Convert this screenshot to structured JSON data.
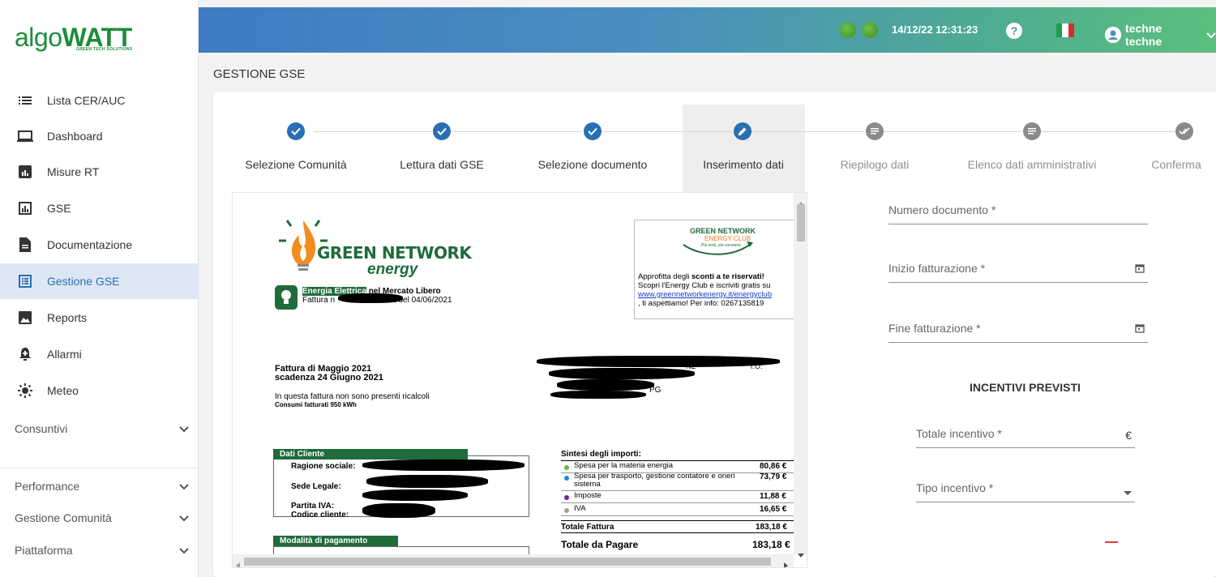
{
  "brand": {
    "name_part1": "algo",
    "name_part2": "WATT",
    "tagline": "GREEN TECH SOLUTIONS"
  },
  "sidebar": {
    "items": [
      {
        "label": "Lista CER/AUC",
        "icon": "list-icon"
      },
      {
        "label": "Dashboard",
        "icon": "laptop-icon"
      },
      {
        "label": "Misure RT",
        "icon": "bar-chart-box-icon"
      },
      {
        "label": "GSE",
        "icon": "chart-outline-icon"
      },
      {
        "label": "Documentazione",
        "icon": "document-icon"
      },
      {
        "label": "Gestione GSE",
        "icon": "form-icon",
        "active": true
      },
      {
        "label": "Reports",
        "icon": "image-icon"
      },
      {
        "label": "Allarmi",
        "icon": "bell-plus-icon"
      },
      {
        "label": "Meteo",
        "icon": "sun-icon"
      }
    ],
    "groups": [
      {
        "label": "Consuntivi"
      },
      {
        "label": "Performance"
      },
      {
        "label": "Gestione Comunità"
      },
      {
        "label": "Piattaforma"
      }
    ]
  },
  "topbar": {
    "datetime": "14/12/22 12:31:23",
    "help": "?",
    "user": "techne techne",
    "status_color": "#4caf2f"
  },
  "page": {
    "title": "GESTIONE GSE"
  },
  "stepper": {
    "steps": [
      {
        "label": "Selezione Comunità",
        "state": "done"
      },
      {
        "label": "Lettura dati GSE",
        "state": "done"
      },
      {
        "label": "Selezione documento",
        "state": "done"
      },
      {
        "label": "Inserimento dati",
        "state": "active"
      },
      {
        "label": "Riepilogo dati",
        "state": "todo"
      },
      {
        "label": "Elenco dati amministrativi",
        "state": "todo"
      },
      {
        "label": "Conferma",
        "state": "done-grey"
      }
    ]
  },
  "document": {
    "brand_line1": "GREEN NETWORK",
    "brand_line2": "energy",
    "bill_type": "Energia Elettrica",
    "bill_type_rest": " nel Mercato Libero",
    "invoice_line": "Fattura n",
    "invoice_date": "E del 04/06/2021",
    "club_title1": "GREEN NETWORK",
    "club_title2": "ENERGY CLUB",
    "club_title3": "Più resti, più conviene",
    "promo_line1a": "Approfitta degli ",
    "promo_line1b": "sconti a te riservati!",
    "promo_line2": "Scopri l'Energy Club e iscriviti gratis su",
    "promo_link": "www.greennetworkenergy.it/energyclub",
    "promo_line4": ", ti aspettiamo! Per info: 0267135819",
    "month_title": "Fattura di Maggio 2021",
    "due_title": "scadenza 24 Giugno 2021",
    "recalc_note": "In questa fattura non sono presenti ricalcoli",
    "consumption": "Consumi fatturati 950 kWh",
    "client_header": "Dati Cliente",
    "client_fields": [
      "Ragione sociale:",
      "Sede Legale:",
      "Partita IVA:",
      "Codice cliente:"
    ],
    "payment_header": "Modalità di pagamento",
    "summary_title": "Sintesi degli importi:",
    "summary_rows": [
      {
        "label": "Spesa per la materia energia",
        "value": "80,86 €",
        "dot": "#5fb63c"
      },
      {
        "label": "Spesa per trasporto,  gestione contatore e oneri sistema",
        "value": "73,79 €",
        "dot": "#1e88e5"
      },
      {
        "label": "Imposte",
        "value": "11,88 €",
        "dot": "#7b1fa2"
      },
      {
        "label": "IVA",
        "value": "16,65 €",
        "dot": "#9e9e9e"
      }
    ],
    "total_invoice_label": "Totale Fattura",
    "total_invoice_value": "183,18 €",
    "total_pay_label": "Totale da Pagare",
    "total_pay_value": "183,18 €",
    "partial_text_1": "PG",
    "partial_text_2": "NE",
    "partial_text_3": "r.O."
  },
  "form": {
    "numero_documento": "Numero documento *",
    "inizio_fatturazione": "Inizio fatturazione *",
    "fine_fatturazione": "Fine fatturazione *",
    "section_title": "INCENTIVI PREVISTI",
    "totale_incentivo": "Totale incentivo *",
    "currency_suffix": "€",
    "tipo_incentivo": "Tipo incentivo *"
  }
}
